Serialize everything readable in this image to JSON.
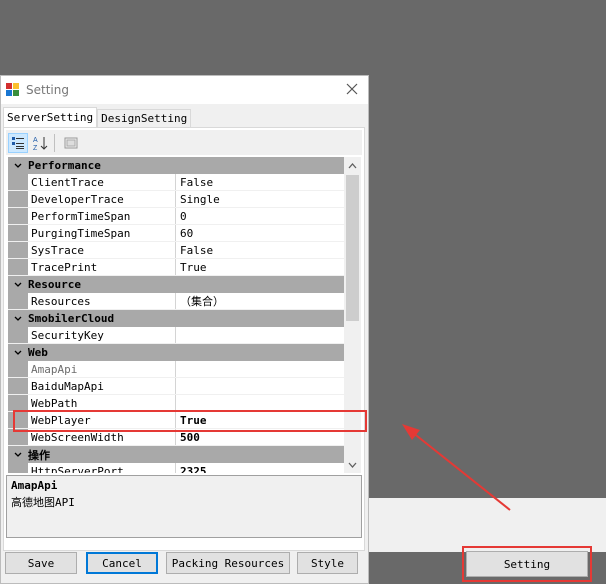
{
  "window": {
    "title": "Setting",
    "close_glyph": "✕"
  },
  "tabs": [
    {
      "label": "ServerSetting",
      "active": true
    },
    {
      "label": "DesignSetting",
      "active": false
    }
  ],
  "toolbar": {
    "icons": [
      "categorized-icon",
      "alphabetical-icon",
      "property-pages-icon"
    ]
  },
  "grid": {
    "categories": [
      {
        "name": "Performance",
        "rows": [
          {
            "name": "ClientTrace",
            "value": "False"
          },
          {
            "name": "DeveloperTrace",
            "value": "Single"
          },
          {
            "name": "PerformTimeSpan",
            "value": "0"
          },
          {
            "name": "PurgingTimeSpan",
            "value": "60"
          },
          {
            "name": "SysTrace",
            "value": "False"
          },
          {
            "name": "TracePrint",
            "value": "True"
          }
        ]
      },
      {
        "name": "Resource",
        "rows": [
          {
            "name": "Resources",
            "value": "（集合）"
          }
        ]
      },
      {
        "name": "SmobilerCloud",
        "rows": [
          {
            "name": "SecurityKey",
            "value": ""
          }
        ]
      },
      {
        "name": "Web",
        "rows": [
          {
            "name": "AmapApi",
            "value": ""
          },
          {
            "name": "BaiduMapApi",
            "value": ""
          },
          {
            "name": "WebPath",
            "value": ""
          },
          {
            "name": "WebPlayer",
            "value": "True"
          },
          {
            "name": "WebScreenWidth",
            "value": "500"
          }
        ]
      },
      {
        "name": "操作",
        "rows": [
          {
            "name": "HttpServerPort",
            "value": "2325"
          }
        ]
      }
    ]
  },
  "description": {
    "title": "AmapApi",
    "text": "高德地图API"
  },
  "buttons": {
    "save": "Save",
    "cancel": "Cancel",
    "packing": "Packing Resources",
    "style": "Style"
  },
  "background": {
    "setting_button": "Setting"
  },
  "colors": {
    "highlight": "#e53935",
    "category_bg": "#a9a9a9",
    "accent": "#0078d7"
  }
}
